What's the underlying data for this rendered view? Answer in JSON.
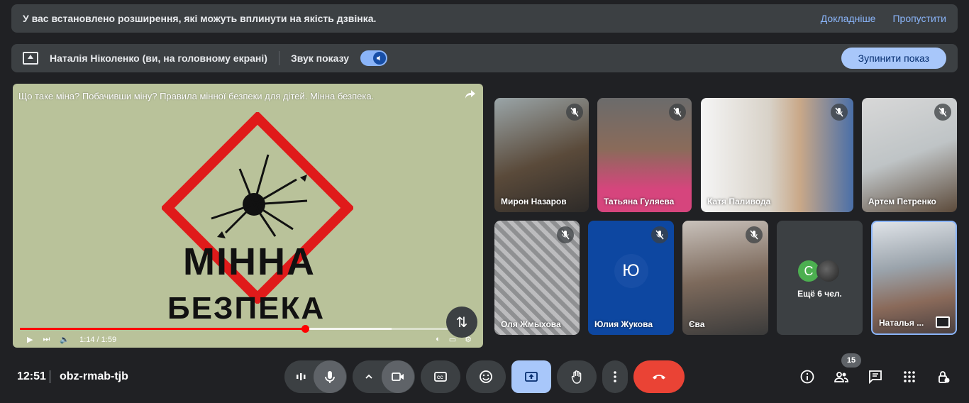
{
  "banner": {
    "text": "У вас встановлено розширення, які можуть вплинути на якість дзвінка.",
    "details_link": "Докладніше",
    "skip_link": "Пропустити"
  },
  "presenting": {
    "name": "Наталія Ніколенко (ви, на головному екрані)",
    "sound_label": "Звук показу",
    "sound_on": true,
    "stop_label": "Зупинити показ"
  },
  "video": {
    "title": "Що таке міна? Побачивши міну? Правила мінної безпеки для дітей. Мінна безпека.",
    "line1": "Мінна",
    "line2": "безпека",
    "time": "1:14 / 1:59",
    "progress": 0.625
  },
  "participants": [
    {
      "name": "Мирон Назаров"
    },
    {
      "name": "Татьяна Гуляева"
    },
    {
      "name": "Катя Паливода"
    },
    {
      "name": "Артем Петренко"
    },
    {
      "name": "Оля Жмыхова"
    },
    {
      "name": "Юлия Жукова",
      "initial": "Ю"
    },
    {
      "name": "Єва"
    },
    {
      "name": "Наталья ..."
    }
  ],
  "more": {
    "initial": "С",
    "label": "Ещё 6 чел."
  },
  "footer": {
    "time": "12:51",
    "meeting_code": "obz-rmab-tjb",
    "participants_count": "15"
  },
  "colors": {
    "background": "#202124",
    "end_call": "#ea4335",
    "accent": "#8ab4f8"
  }
}
